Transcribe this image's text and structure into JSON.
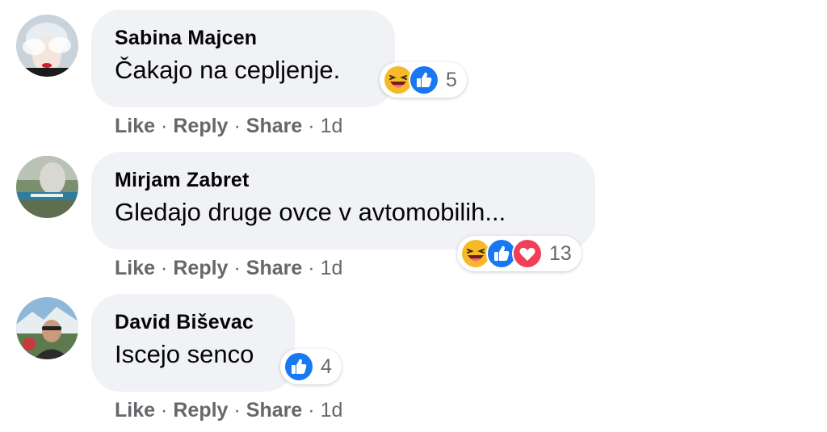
{
  "comments": [
    {
      "author": "Sabina Majcen",
      "text": "Čakajo na cepljenje.",
      "reactions": [
        "haha",
        "like"
      ],
      "reaction_count": "5",
      "actions": {
        "like": "Like",
        "reply": "Reply",
        "share": "Share",
        "time": "1d"
      },
      "separator": "·"
    },
    {
      "author": "Mirjam Zabret",
      "text": "Gledajo druge ovce v avtomobilih...",
      "reactions": [
        "haha",
        "like",
        "love"
      ],
      "reaction_count": "13",
      "actions": {
        "like": "Like",
        "reply": "Reply",
        "share": "Share",
        "time": "1d"
      },
      "separator": "·"
    },
    {
      "author": "David Biševac",
      "text": "Iscejo senco",
      "reactions": [
        "like"
      ],
      "reaction_count": "4",
      "actions": {
        "like": "Like",
        "reply": "Reply",
        "share": "Share",
        "time": "1d"
      },
      "separator": "·"
    }
  ],
  "colors": {
    "bubble_bg": "#f0f2f5",
    "text": "#050505",
    "secondary_text": "#65676b",
    "like_blue": "#1877f2",
    "love_red": "#f33e58",
    "haha_yellow": "#f7b928"
  }
}
